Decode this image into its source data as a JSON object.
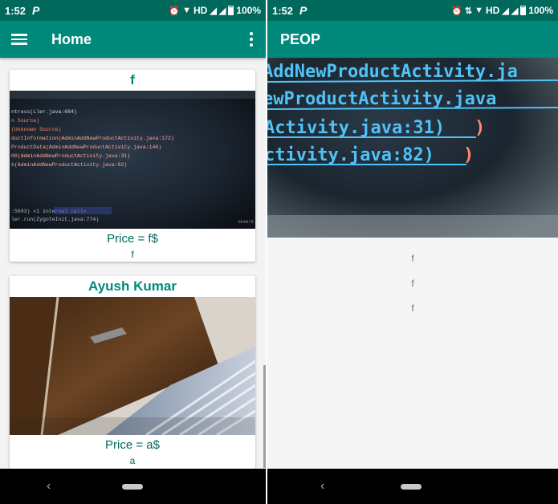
{
  "status_left": {
    "time": "1:52",
    "battery": "100%",
    "network": "HD"
  },
  "status_right": {
    "time": "1:52",
    "battery": "100%",
    "network": "HD"
  },
  "home": {
    "title": "Home",
    "products": [
      {
        "name": "f",
        "price": "Price = f$",
        "description": "f"
      },
      {
        "name": "Ayush Kumar",
        "price": "Price = a$",
        "description": "a"
      }
    ]
  },
  "detail": {
    "title": "PEOP",
    "lines": [
      "f",
      "f",
      "f"
    ]
  },
  "screenshot_code_left": [
    "ntress(Ller.java:684)",
    "n Source)",
    "(Unknown Source)",
    "ductInformation(AdminAddNewProductActivity.java:172)",
    "ProductData(AdminAddNewProductActivity.java:146)",
    "00(AdminAddNewProductActivity.java:31)",
    "k(AdminAddNewProductActivity.java:82)",
    ":5603) <1 internal call>",
    "ler.run(ZygoteInit.java:774)"
  ],
  "screenshot_date": "2019/5",
  "screenshot_code_right": [
    "AddNewProductActivity.ja",
    "ewProductActivity.java",
    "Activity.java:31)",
    "ctivity.java:82)"
  ],
  "colors": {
    "primary": "#00897b",
    "primary_dark": "#00695c",
    "text_teal": "#00695c"
  }
}
